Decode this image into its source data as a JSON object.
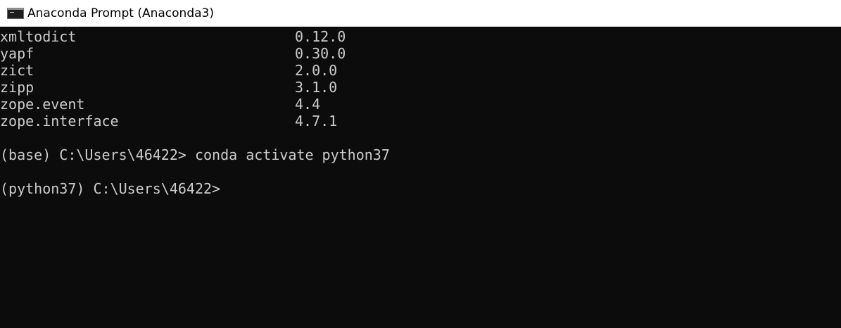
{
  "window": {
    "title": "Anaconda Prompt (Anaconda3)",
    "icon": "terminal-icon"
  },
  "terminal": {
    "packages": [
      {
        "name": "xmltodict",
        "version": "0.12.0"
      },
      {
        "name": "yapf",
        "version": "0.30.0"
      },
      {
        "name": "zict",
        "version": "2.0.0"
      },
      {
        "name": "zipp",
        "version": "3.1.0"
      },
      {
        "name": "zope.event",
        "version": "4.4"
      },
      {
        "name": "zope.interface",
        "version": "4.7.1"
      }
    ],
    "command_line": "(base) C:\\Users\\46422> conda activate python37",
    "prompt_line": "(python37) C:\\Users\\46422>"
  },
  "colors": {
    "background": "#0c0c0c",
    "text": "#cccccc",
    "titlebar": "#ffffff"
  }
}
